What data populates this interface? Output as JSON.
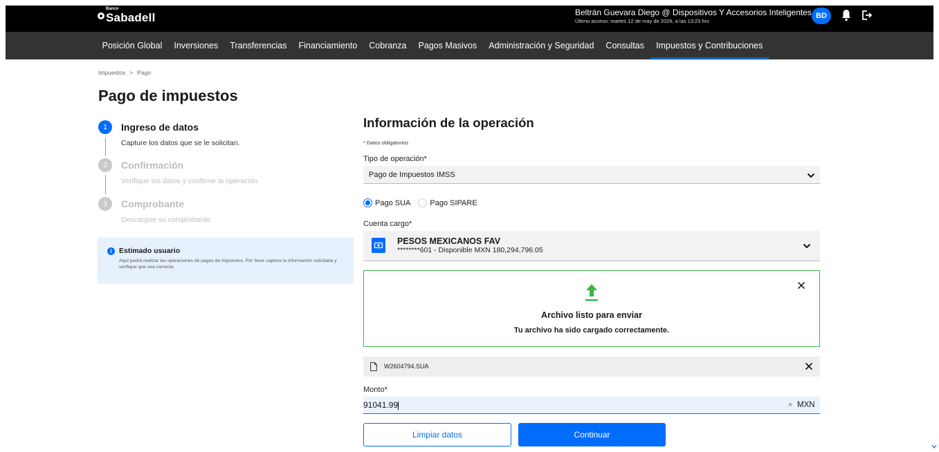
{
  "brand": {
    "small": "Banco",
    "name": "Sabadell"
  },
  "user": {
    "name": "Beltrán Guevara Diego @ Dispositivos Y Accesorios Inteligentes",
    "last_access": "Último acceso: martes 12 de may de 2026, a las 13:23 hrs",
    "initials": "BD"
  },
  "nav": [
    "Posición Global",
    "Inversiones",
    "Transferencias",
    "Financiamiento",
    "Cobranza",
    "Pagos Masivos",
    "Administración y Seguridad",
    "Consultas",
    "Impuestos y Contribuciones"
  ],
  "nav_active_index": 8,
  "breadcrumb": {
    "item1": "Impuestos",
    "separator": ">",
    "item2": "Pago"
  },
  "page_title": "Pago de impuestos",
  "steps": [
    {
      "num": "1",
      "title": "Ingreso de datos",
      "desc": "Capture los datos que se le solicitan.",
      "active": true
    },
    {
      "num": "2",
      "title": "Confirmación",
      "desc": "Verifique los datos y confirme la operación.",
      "active": false
    },
    {
      "num": "3",
      "title": "Comprobante",
      "desc": "Descargue su comprobante.",
      "active": false
    }
  ],
  "info": {
    "icon": "i",
    "title": "Estimado usuario",
    "text": "Aquí podrá realizar las operaciones de pagos de impuestos. Por favor capture la información solicitada y verifique que sea correcta."
  },
  "form": {
    "section_title": "Información de la operación",
    "required_note": "* Datos obligatorios",
    "operation_label": "Tipo de operación*",
    "operation_value": "Pago de Impuestos IMSS",
    "radio_options": [
      "Pago SUA",
      "Pago SIPARE"
    ],
    "radio_selected": 0,
    "account_label": "Cuenta cargo*",
    "account_name": "PESOS MEXICANOS FAV",
    "account_detail": "********601 - Disponible MXN 180,294,796.05",
    "upload_title": "Archivo listo para enviar",
    "upload_subtitle": "Tu archivo ha sido cargado correctamente.",
    "file_name": "W2604794.SUA",
    "amount_label": "Monto*",
    "amount_value": "91041.99",
    "amount_clear": "×",
    "currency": "MXN",
    "clear_button": "Limpiar datos",
    "continue_button": "Continuar"
  },
  "colors": {
    "primary": "#006dff",
    "success": "#3cb54a",
    "topbar": "#000000",
    "navbar": "#333333"
  }
}
